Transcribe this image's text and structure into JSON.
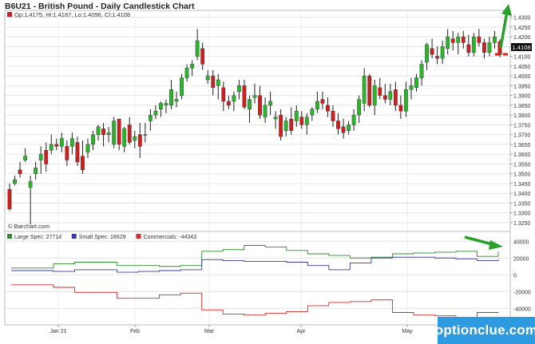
{
  "window": {
    "title": "B6U21 - British Pound - Daily Candlestick Chart"
  },
  "price_panel": {
    "ohlc_legend": "Op:1.4175, Hi:1.4187, Lo:1.4096, Cl:1.4108",
    "source_label": "© Barchart.com",
    "last_price_label": "1.4108"
  },
  "cot_panel": {
    "legend": [
      {
        "label": "Large Spec: 27714",
        "color": "#2e8b2e"
      },
      {
        "label": "Small Spec: 18629",
        "color": "#3a3aa0"
      },
      {
        "label": "Commercials: -44343",
        "color": "#d62a2a"
      }
    ]
  },
  "watermark": {
    "text_main": "optionclue",
    "text_suffix": ".com",
    "bg_color": "#2e9be0"
  },
  "colors": {
    "up": "#2bb52b",
    "down": "#cc1f1f",
    "wick": "#222222",
    "annotation": "#2aa12a",
    "stop_line": "#e01b1b"
  },
  "chart_data": [
    {
      "type": "candlestick",
      "title": "B6U21 - British Pound - Daily Candlestick Chart",
      "x_ticks": [
        "Jan 21",
        "Feb",
        "Mar",
        "Apr",
        "May"
      ],
      "y_ticks": [
        1.43,
        1.425,
        1.42,
        1.415,
        1.41,
        1.405,
        1.4,
        1.395,
        1.39,
        1.385,
        1.38,
        1.375,
        1.37,
        1.365,
        1.36,
        1.355,
        1.35,
        1.345,
        1.34,
        1.335,
        1.33,
        1.325
      ],
      "ylim": [
        1.3205,
        1.4335
      ],
      "grid": true,
      "candles": [
        [
          1.342,
          1.345,
          1.331,
          1.332
        ],
        [
          1.345,
          1.349,
          1.344,
          1.347
        ],
        [
          1.352,
          1.356,
          1.348,
          1.35
        ],
        [
          1.357,
          1.363,
          1.356,
          1.359
        ],
        [
          1.343,
          1.349,
          1.324,
          1.346
        ],
        [
          1.35,
          1.356,
          1.347,
          1.353
        ],
        [
          1.357,
          1.364,
          1.35,
          1.36
        ],
        [
          1.362,
          1.366,
          1.351,
          1.355
        ],
        [
          1.362,
          1.37,
          1.36,
          1.365
        ],
        [
          1.365,
          1.368,
          1.362,
          1.364
        ],
        [
          1.364,
          1.371,
          1.361,
          1.368
        ],
        [
          1.364,
          1.367,
          1.354,
          1.357
        ],
        [
          1.364,
          1.371,
          1.36,
          1.368
        ],
        [
          1.366,
          1.369,
          1.354,
          1.356
        ],
        [
          1.359,
          1.367,
          1.35,
          1.352
        ],
        [
          1.361,
          1.368,
          1.358,
          1.365
        ],
        [
          1.365,
          1.372,
          1.362,
          1.37
        ],
        [
          1.37,
          1.375,
          1.367,
          1.374
        ],
        [
          1.373,
          1.376,
          1.364,
          1.37
        ],
        [
          1.37,
          1.374,
          1.366,
          1.371
        ],
        [
          1.365,
          1.379,
          1.363,
          1.377
        ],
        [
          1.378,
          1.377,
          1.362,
          1.365
        ],
        [
          1.364,
          1.374,
          1.361,
          1.373
        ],
        [
          1.375,
          1.379,
          1.365,
          1.366
        ],
        [
          1.367,
          1.372,
          1.363,
          1.369
        ],
        [
          1.37,
          1.376,
          1.358,
          1.364
        ],
        [
          1.37,
          1.376,
          1.366,
          1.37
        ],
        [
          1.377,
          1.383,
          1.372,
          1.38
        ],
        [
          1.38,
          1.385,
          1.378,
          1.382
        ],
        [
          1.383,
          1.387,
          1.379,
          1.386
        ],
        [
          1.385,
          1.388,
          1.381,
          1.386
        ],
        [
          1.385,
          1.398,
          1.383,
          1.393
        ],
        [
          1.387,
          1.392,
          1.384,
          1.388
        ],
        [
          1.39,
          1.401,
          1.388,
          1.399
        ],
        [
          1.399,
          1.406,
          1.397,
          1.404
        ],
        [
          1.404,
          1.408,
          1.4,
          1.406
        ],
        [
          1.41,
          1.424,
          1.408,
          1.418
        ],
        [
          1.414,
          1.417,
          1.403,
          1.406
        ],
        [
          1.398,
          1.403,
          1.396,
          1.4
        ],
        [
          1.4,
          1.403,
          1.39,
          1.394
        ],
        [
          1.395,
          1.401,
          1.388,
          1.398
        ],
        [
          1.394,
          1.397,
          1.382,
          1.387
        ],
        [
          1.387,
          1.39,
          1.383,
          1.385
        ],
        [
          1.387,
          1.392,
          1.382,
          1.39
        ],
        [
          1.392,
          1.398,
          1.388,
          1.395
        ],
        [
          1.395,
          1.398,
          1.383,
          1.384
        ],
        [
          1.383,
          1.39,
          1.376,
          1.388
        ],
        [
          1.389,
          1.396,
          1.386,
          1.39
        ],
        [
          1.39,
          1.395,
          1.378,
          1.38
        ],
        [
          1.379,
          1.389,
          1.376,
          1.385
        ],
        [
          1.385,
          1.392,
          1.38,
          1.387
        ],
        [
          1.378,
          1.382,
          1.373,
          1.379
        ],
        [
          1.38,
          1.383,
          1.367,
          1.369
        ],
        [
          1.372,
          1.379,
          1.369,
          1.377
        ],
        [
          1.378,
          1.384,
          1.37,
          1.372
        ],
        [
          1.377,
          1.385,
          1.374,
          1.382
        ],
        [
          1.379,
          1.382,
          1.373,
          1.375
        ],
        [
          1.375,
          1.381,
          1.37,
          1.379
        ],
        [
          1.38,
          1.384,
          1.377,
          1.383
        ],
        [
          1.383,
          1.392,
          1.381,
          1.387
        ],
        [
          1.388,
          1.392,
          1.383,
          1.386
        ],
        [
          1.385,
          1.389,
          1.379,
          1.382
        ],
        [
          1.382,
          1.385,
          1.374,
          1.377
        ],
        [
          1.377,
          1.381,
          1.37,
          1.373
        ],
        [
          1.374,
          1.378,
          1.368,
          1.371
        ],
        [
          1.372,
          1.377,
          1.37,
          1.375
        ],
        [
          1.375,
          1.383,
          1.372,
          1.38
        ],
        [
          1.38,
          1.39,
          1.376,
          1.388
        ],
        [
          1.386,
          1.404,
          1.382,
          1.4
        ],
        [
          1.4,
          1.401,
          1.384,
          1.385
        ],
        [
          1.385,
          1.398,
          1.38,
          1.395
        ],
        [
          1.394,
          1.399,
          1.388,
          1.39
        ],
        [
          1.39,
          1.396,
          1.386,
          1.388
        ],
        [
          1.388,
          1.396,
          1.385,
          1.392
        ],
        [
          1.393,
          1.397,
          1.382,
          1.385
        ],
        [
          1.385,
          1.39,
          1.378,
          1.382
        ],
        [
          1.382,
          1.397,
          1.379,
          1.393
        ],
        [
          1.393,
          1.399,
          1.388,
          1.395
        ],
        [
          1.394,
          1.401,
          1.392,
          1.399
        ],
        [
          1.399,
          1.408,
          1.395,
          1.406
        ],
        [
          1.407,
          1.417,
          1.403,
          1.416
        ],
        [
          1.414,
          1.419,
          1.409,
          1.411
        ],
        [
          1.41,
          1.415,
          1.406,
          1.409
        ],
        [
          1.409,
          1.418,
          1.406,
          1.415
        ],
        [
          1.414,
          1.424,
          1.411,
          1.42
        ],
        [
          1.419,
          1.423,
          1.413,
          1.417
        ],
        [
          1.417,
          1.422,
          1.411,
          1.42
        ],
        [
          1.42,
          1.423,
          1.414,
          1.417
        ],
        [
          1.416,
          1.421,
          1.41,
          1.412
        ],
        [
          1.412,
          1.422,
          1.41,
          1.42
        ],
        [
          1.42,
          1.424,
          1.415,
          1.417
        ],
        [
          1.417,
          1.419,
          1.409,
          1.412
        ],
        [
          1.412,
          1.42,
          1.41,
          1.417
        ],
        [
          1.417,
          1.423,
          1.414,
          1.42
        ],
        [
          1.4175,
          1.4187,
          1.4096,
          1.4108
        ]
      ]
    },
    {
      "type": "step-line",
      "title": "COT",
      "y_ticks": [
        40000,
        20000,
        0,
        -20000,
        -40000
      ],
      "ylim": [
        -55000,
        45000
      ],
      "series": [
        {
          "name": "Large Spec",
          "color": "#2e8b2e",
          "values": [
            8000,
            8000,
            13000,
            15000,
            15000,
            11000,
            11000,
            10000,
            11000,
            28000,
            30000,
            35000,
            33000,
            29000,
            25000,
            23000,
            20000,
            21000,
            25000,
            26000,
            27000,
            28000,
            22000,
            27714
          ]
        },
        {
          "name": "Small Spec",
          "color": "#3a3aa0",
          "values": [
            5000,
            5000,
            4000,
            6000,
            6000,
            3000,
            4000,
            5000,
            6000,
            18000,
            17000,
            16000,
            16000,
            15000,
            11000,
            6000,
            14000,
            20000,
            21000,
            21000,
            20000,
            19000,
            17000,
            18629
          ]
        },
        {
          "name": "Commercials",
          "color": "#d62a2a",
          "values": [
            -12000,
            -12000,
            -15000,
            -21000,
            -21000,
            -28000,
            -28000,
            -24000,
            -22000,
            -42000,
            -47000,
            -48000,
            -46000,
            -44000,
            -37000,
            -33000,
            -32000,
            -30000,
            -45000,
            -48000,
            -49000,
            -52000,
            -45000,
            -44343
          ]
        }
      ]
    }
  ]
}
